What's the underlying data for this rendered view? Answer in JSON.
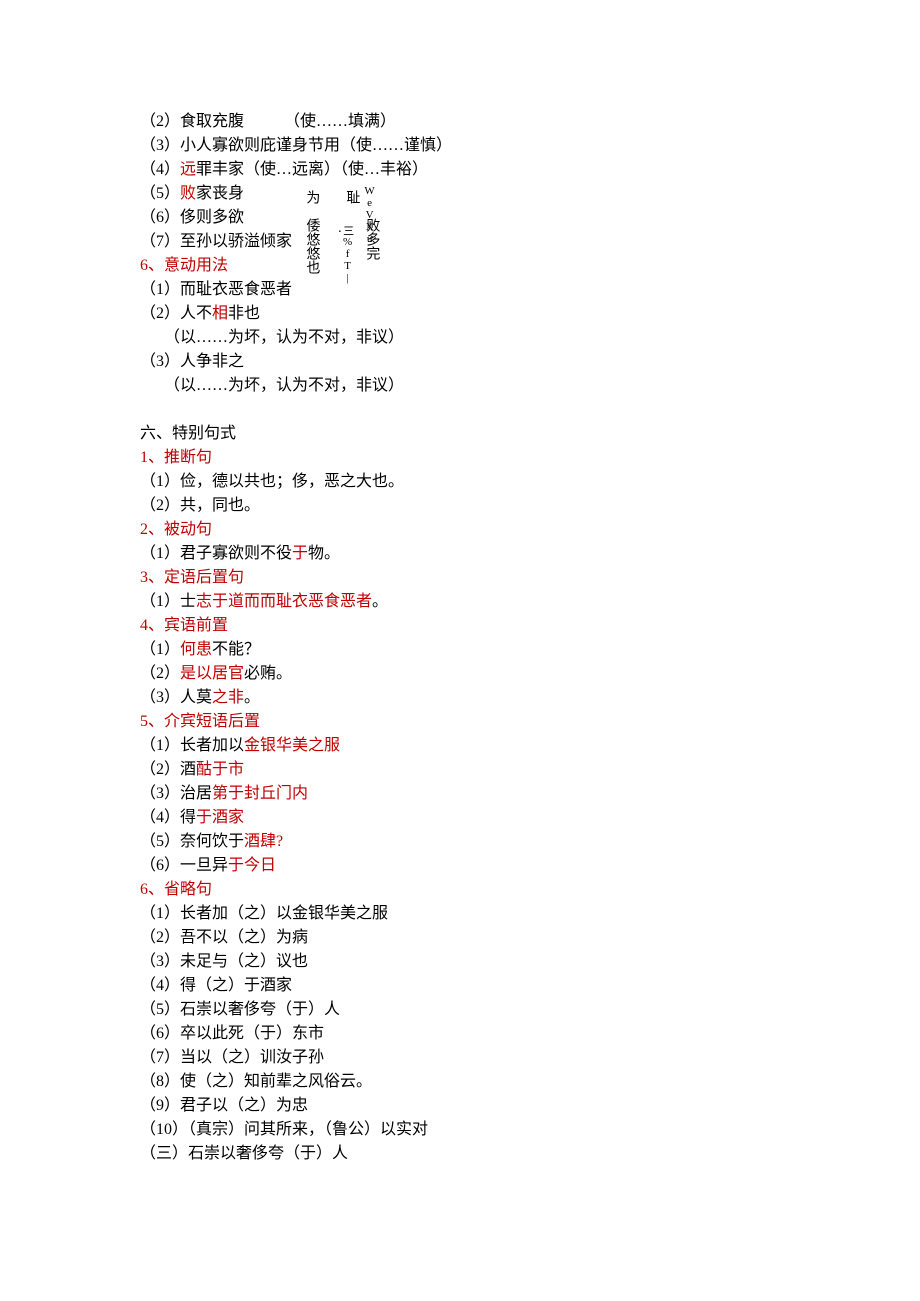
{
  "lines": {
    "l1": "（2）食取充腹",
    "l1_gloss": "（使……填满）",
    "l2": "（3）小人寡欲则庇谨身节用（使……谨慎）",
    "l3a": "（4）",
    "l3b": "远",
    "l3c": "罪丰家（使…远离）（使…丰裕）",
    "l4a": "（5）",
    "l4b": "败",
    "l4c": "家丧身",
    "l5": "（6）侈则多欲",
    "l6": "（7）至孙以骄溢倾家",
    "l7a": "6、意动用法",
    "l8a": "（1）而耻衣恶食恶者",
    "l9": "（2）人不",
    "l9b": "相",
    "l9c": "非也",
    "l10": "      （以……为坏，认为不对，非议）",
    "l11": "（3）人争非之",
    "l12": "      （以……为坏，认为不对，非议）",
    "l13": "六、特别句式",
    "l14": "1、推断句",
    "l15": "（1）俭，德以共也；侈，恶之大也。",
    "l16": "（2）共，同也。",
    "l17": "2、被动句",
    "l18a": "（1）君子寡欲则不役",
    "l18b": "于",
    "l18c": "物。",
    "l19": "3、定语后置句",
    "l20a": "（1）士",
    "l20b": "志于道而而耻衣恶食恶者",
    "l20c": "。",
    "l21": "4、宾语前置",
    "l22a": "（1）",
    "l22b": "何患",
    "l22c": "不能？",
    "l23a": "（2）",
    "l23b": "是以居官",
    "l23c": "必贿。",
    "l24a": "（3）人莫",
    "l24b": "之非",
    "l24c": "。",
    "l25": "5、介宾短语后置",
    "l26a": "（1）长者加以",
    "l26b": "金银华美之服",
    "l27a": "（2）酒",
    "l27b": "酤于市",
    "l28a": "（3）治居",
    "l28b": "第于封丘门内",
    "l29a": "（4）得",
    "l29b": "于酒家",
    "l30a": "（5）奈何饮于",
    "l30b": "酒肆?",
    "l31a": "（6）一旦异",
    "l31b": "于今日",
    "l32": "6、省略句",
    "l33": "（1）长者加（之）以金银华美之服",
    "l34": "（2）吾不以（之）为病",
    "l35": "（3）未足与（之）议也",
    "l36": "（4）得（之）于酒家",
    "l37": "（5）石崇以奢侈夸（于）人",
    "l38": "（6）卒以此死（于）东市",
    "l39": "（7）当以（之）训汝子孙",
    "l40": "（8）使（之）知前辈之风俗云。",
    "l41": "（9）君子以（之）为忠",
    "l42": "（10）（真宗）问其所来，（鲁公）以实对",
    "l43": "（三）石崇以奢侈夸（于）人"
  },
  "vertical": {
    "col1": "为",
    "col2": "耻",
    "col3_small": "WeVXu",
    "col4": "倭悠悠也",
    "col5": "·",
    "col6_small": "三%fT|",
    "col7": "败多完"
  }
}
